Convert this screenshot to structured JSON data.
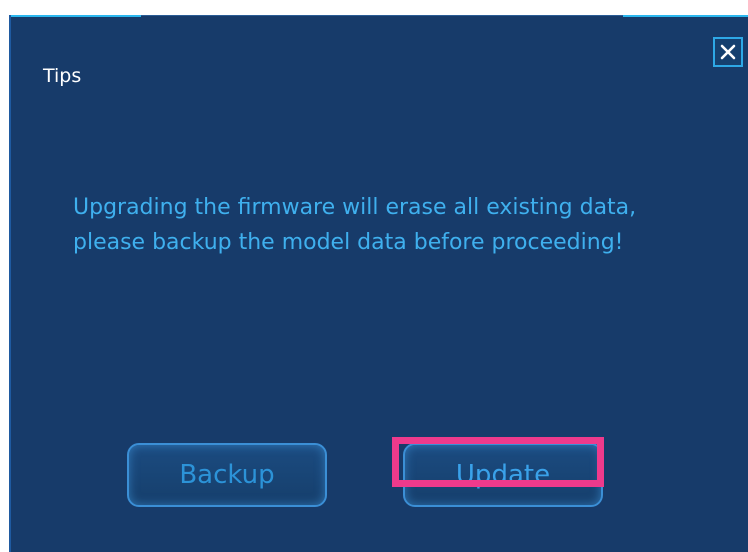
{
  "dialog": {
    "title": "Tips",
    "close_icon": "close-icon",
    "message": "Upgrading the firmware will erase all existing data, please backup the model data before proceeding!",
    "buttons": {
      "backup_label": "Backup",
      "update_label": "Update"
    }
  },
  "colors": {
    "background": "#173b6a",
    "accent": "#2bb7ee",
    "message_text": "#3fb0ee",
    "highlight": "#ee3a8c"
  }
}
